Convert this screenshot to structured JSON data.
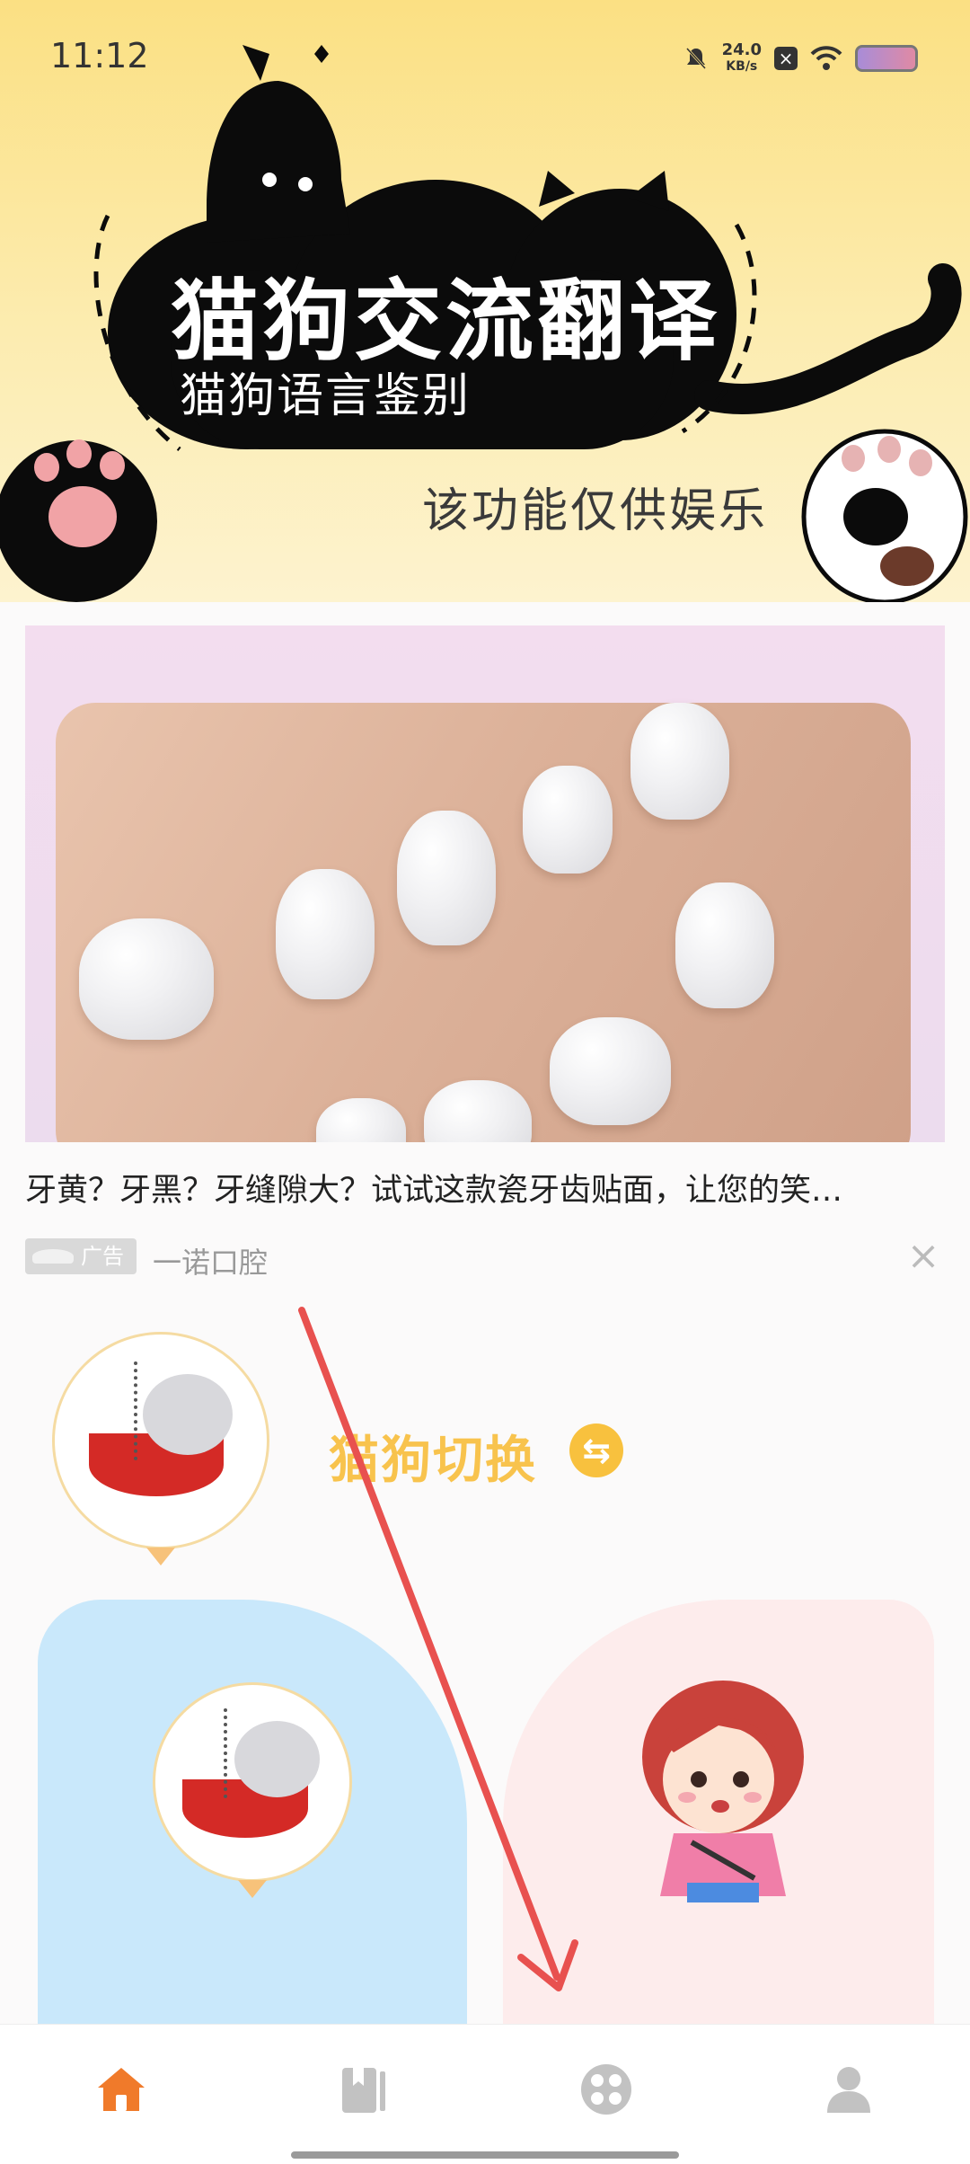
{
  "status_bar": {
    "time": "11:12",
    "net_speed_value": "24.0",
    "net_speed_unit": "KB/s"
  },
  "banner": {
    "title": "猫狗交流翻译",
    "subtitle": "猫狗语言鉴别",
    "note": "该功能仅供娱乐"
  },
  "ad": {
    "headline": "牙黄？牙黑？牙缝隙大？试试这款瓷牙齿贴面，让您的笑…",
    "tag": "广告",
    "brand": "一诺口腔",
    "close_icon": "close-icon"
  },
  "switcher": {
    "label": "猫狗切换",
    "icon": "swap-icon"
  },
  "nav": {
    "items": [
      {
        "icon": "home-icon",
        "active": true,
        "color": "#f07a2a"
      },
      {
        "icon": "book-icon",
        "active": false,
        "color": "#c2c2c2"
      },
      {
        "icon": "apps-icon",
        "active": false,
        "color": "#c2c2c2"
      },
      {
        "icon": "profile-icon",
        "active": false,
        "color": "#c2c2c2"
      }
    ]
  },
  "colors": {
    "accent": "#f07a2a",
    "switch_yellow": "#f8c34d",
    "annotation_arrow": "#e8514f"
  }
}
